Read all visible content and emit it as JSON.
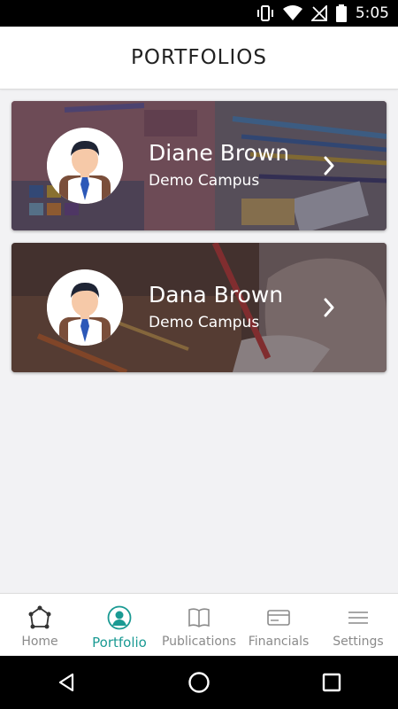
{
  "status_bar": {
    "time": "5:05",
    "icons": [
      "vibrate-icon",
      "wifi-icon",
      "no-signal-icon",
      "battery-icon"
    ]
  },
  "header": {
    "title": "PORTFOLIOS"
  },
  "portfolios": [
    {
      "name": "Diane Brown",
      "campus": "Demo Campus"
    },
    {
      "name": "Dana Brown",
      "campus": "Demo Campus"
    }
  ],
  "tabs": [
    {
      "label": "Home",
      "icon": "home-icon",
      "active": false
    },
    {
      "label": "Portfolio",
      "icon": "portfolio-icon",
      "active": true
    },
    {
      "label": "Publications",
      "icon": "book-icon",
      "active": false
    },
    {
      "label": "Financials",
      "icon": "card-icon",
      "active": false
    },
    {
      "label": "Settings",
      "icon": "menu-icon",
      "active": false
    }
  ],
  "colors": {
    "accent": "#1a9a93",
    "inactive": "#8a8a8a"
  },
  "nav_buttons": [
    "back-icon",
    "home-circle-icon",
    "recents-icon"
  ]
}
